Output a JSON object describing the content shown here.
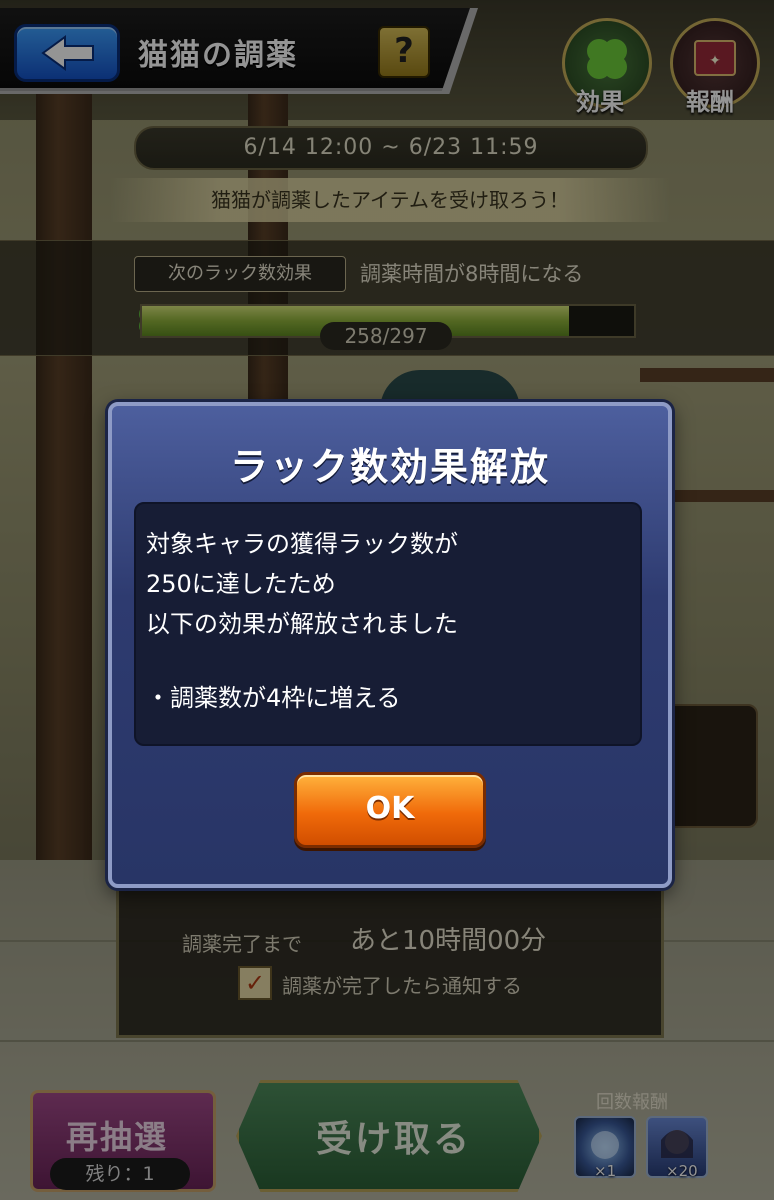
{
  "header": {
    "title": "猫猫の調薬",
    "help_label": "?",
    "effect_label": "効果",
    "reward_label": "報酬"
  },
  "event": {
    "period": "6/14 12:00 ~ 6/23 11:59",
    "subtitle": "猫猫が調薬したアイテムを受け取ろう！",
    "next_effect_tag": "次のラック数効果",
    "next_effect_text": "調薬時間が8時間になる",
    "luck_progress": "258/297",
    "luck_current": 258,
    "luck_max": 297
  },
  "modal": {
    "title": "ラック数効果解放",
    "lines": [
      "対象キャラの獲得ラック数が",
      "250に達したため",
      "以下の効果が解放されました"
    ],
    "bullet": "・調薬数が4枠に増える",
    "ok_label": "OK"
  },
  "bottom": {
    "remain_label": "調薬完了まで",
    "remain_time": "あと10時間00分",
    "notify_checked": true,
    "notify_label": "調薬が完了したら通知する",
    "reroll_label": "再抽選",
    "remaining_label": "残り：1",
    "receive_label": "受け取る",
    "count_reward_label": "回数報酬",
    "reward_items": [
      {
        "icon": "orb-icon",
        "count": "×1"
      },
      {
        "icon": "character-portrait-icon",
        "count": "×20"
      }
    ]
  },
  "colors": {
    "modal_bg": "#2e3b70",
    "ok_button": "#f06a0a",
    "back_button": "#1553c9",
    "gauge_fill": "#8fb23b"
  }
}
